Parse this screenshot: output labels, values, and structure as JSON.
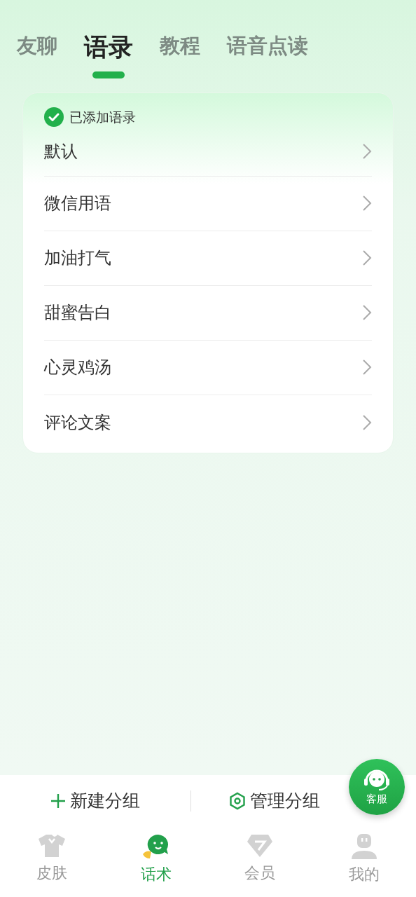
{
  "tabs": [
    {
      "label": "友聊",
      "selected": false
    },
    {
      "label": "语录",
      "selected": true
    },
    {
      "label": "教程",
      "selected": false
    },
    {
      "label": "语音点读",
      "selected": false
    }
  ],
  "card": {
    "header": "已添加语录",
    "items": [
      "默认",
      "微信用语",
      "加油打气",
      "甜蜜告白",
      "心灵鸡汤",
      "评论文案"
    ]
  },
  "actions": [
    {
      "kind": "add",
      "label": "新建分组"
    },
    {
      "kind": "manage",
      "label": "管理分组"
    }
  ],
  "support_button": {
    "label": "客服"
  },
  "bottom_nav": [
    {
      "kind": "skin",
      "label": "皮肤",
      "selected": false
    },
    {
      "kind": "talk",
      "label": "话术",
      "selected": true
    },
    {
      "kind": "vip",
      "label": "会员",
      "selected": false
    },
    {
      "kind": "me",
      "label": "我的",
      "selected": false
    }
  ]
}
